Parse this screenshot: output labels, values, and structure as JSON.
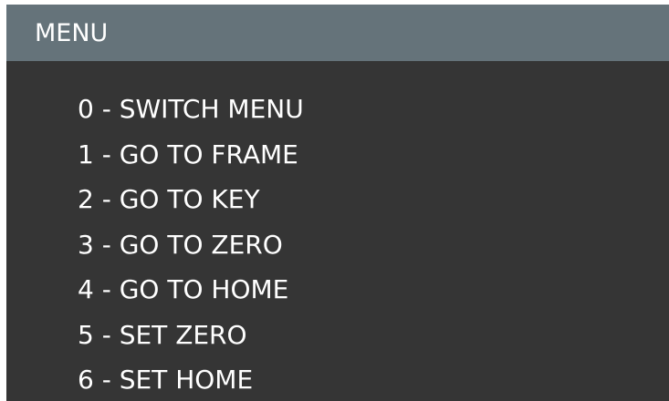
{
  "colors": {
    "header_bg": "#65737a",
    "body_bg": "#353535",
    "text": "#ffffff"
  },
  "header": {
    "title": "MENU"
  },
  "menu": {
    "items": [
      {
        "label": "0 - SWITCH MENU"
      },
      {
        "label": "1 - GO TO FRAME"
      },
      {
        "label": "2 - GO TO KEY"
      },
      {
        "label": "3 - GO TO ZERO"
      },
      {
        "label": "4 - GO TO HOME"
      },
      {
        "label": "5 - SET ZERO"
      },
      {
        "label": "6 - SET HOME"
      }
    ]
  }
}
